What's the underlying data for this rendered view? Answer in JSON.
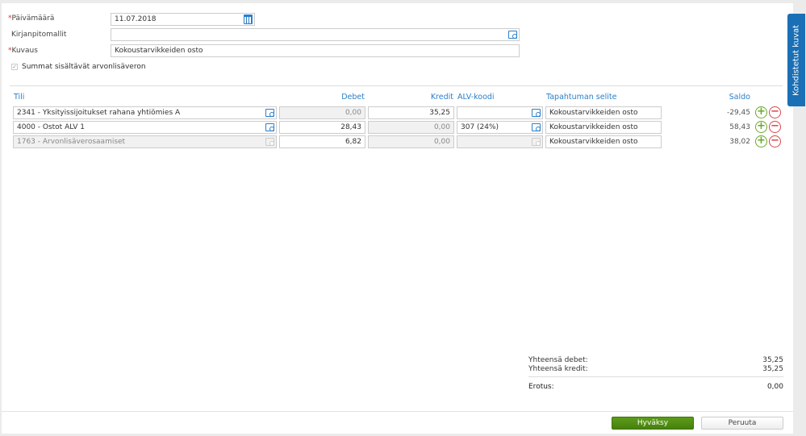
{
  "form": {
    "date_label": "Päivämäärä",
    "date_value": "11.07.2018",
    "templates_label": "Kirjanpitomallit",
    "templates_value": "",
    "description_label": "Kuvaus",
    "description_value": "Kokoustarvikkeiden osto",
    "vat_checkbox_label": "Summat sisältävät arvonlisäveron",
    "vat_checked": true,
    "required_marker": "*"
  },
  "table": {
    "headers": {
      "account": "Tili",
      "debit": "Debet",
      "credit": "Kredit",
      "vat": "ALV-koodi",
      "desc": "Tapahtuman selite",
      "balance": "Saldo"
    },
    "rows": [
      {
        "account": "2341 - Yksityissijoitukset rahana yhtiömies A",
        "debit": "0,00",
        "credit": "35,25",
        "vat": "",
        "desc": "Kokoustarvikkeiden osto",
        "balance": "-29,45",
        "disabled": false
      },
      {
        "account": "4000 - Ostot ALV 1",
        "debit": "28,43",
        "credit": "0,00",
        "vat": "307 (24%)",
        "desc": "Kokoustarvikkeiden osto",
        "balance": "58,43",
        "disabled": false
      },
      {
        "account": "1763 - Arvonlisäverosaamiset",
        "debit": "6,82",
        "credit": "0,00",
        "vat": "",
        "desc": "Kokoustarvikkeiden osto",
        "balance": "38,02",
        "disabled": true
      }
    ]
  },
  "totals": {
    "debit_label": "Yhteensä debet:",
    "debit_value": "35,25",
    "credit_label": "Yhteensä kredit:",
    "credit_value": "35,25",
    "diff_label": "Erotus:",
    "diff_value": "0,00"
  },
  "buttons": {
    "approve": "Hyväksy",
    "cancel": "Peruuta"
  },
  "side_tab": "Kohdistetut kuvat",
  "colors": {
    "accent": "#2a7fc9",
    "approve": "#4f8a12",
    "side_tab": "#1a6fb5",
    "add": "#6aa82a",
    "remove": "#d9474b"
  }
}
